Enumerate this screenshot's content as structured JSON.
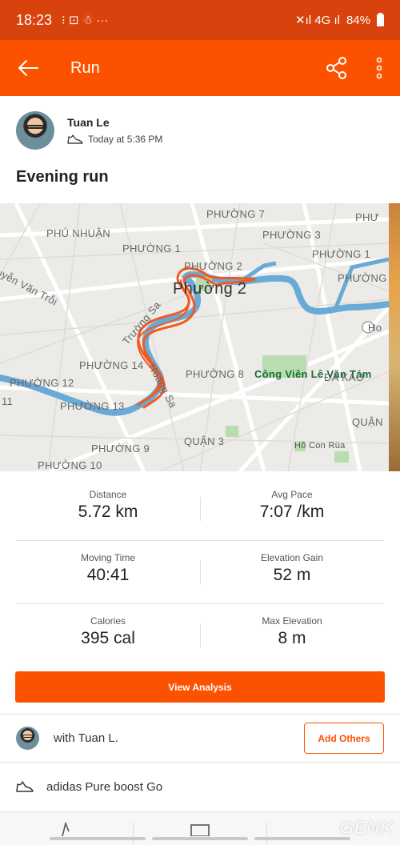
{
  "status_bar": {
    "time": "18:23",
    "left_glyphs": "⁝ ⊡ ☃ ···",
    "signal_glyphs": "✕ıl  4G ıl",
    "battery": "84%"
  },
  "app_bar": {
    "title": "Run",
    "back_icon": "arrow-left-icon",
    "share_icon": "share-icon",
    "more_icon": "more-vertical-icon",
    "color": "#fc5200"
  },
  "athlete": {
    "name": "Tuan Le",
    "activity_icon": "shoe-icon",
    "time": "Today at 5:36 PM"
  },
  "activity": {
    "title": "Evening run"
  },
  "map": {
    "labels": {
      "phuong7": "PHƯỜNG 7",
      "phuNhuan": "PHÚ NHUẬN",
      "phuong1a": "PHƯỜNG 1",
      "phuong3": "PHƯỜNG 3",
      "phuong1b": "PHƯỜNG 1",
      "phuong2caps": "PHƯỜNG 2",
      "phuong2big": "Phường 2",
      "nguyenVanTroi": "uyễn Văn Trỗi",
      "truongSa": "Trường Sa",
      "hoangSa": "Hoàng Sa",
      "phuong14": "PHƯỜNG 14",
      "phuong8": "PHƯỜNG 8",
      "congVien": "Công Viên Lê Văn Tám",
      "daKao": "ĐA KAO",
      "phuong12": "PHƯỜNG 12",
      "phuong13": "PHƯỜNG 13",
      "eleven": "11",
      "quan": "QUẬN",
      "phuong9": "PHƯỜNG 9",
      "quan3": "QUẬN 3",
      "hoCon": "Hồ Con Rùa",
      "phuong10": "PHƯỜNG 10",
      "phuTop": "PHƯ",
      "phuongRight": "PHƯỜNG",
      "ho": "Ho"
    },
    "route_color": "#f05a22",
    "river_color": "#6aaad6"
  },
  "stats": [
    [
      {
        "label": "Distance",
        "value": "5.72 km"
      },
      {
        "label": "Avg Pace",
        "value": "7:07 /km"
      }
    ],
    [
      {
        "label": "Moving Time",
        "value": "40:41"
      },
      {
        "label": "Elevation Gain",
        "value": "52 m"
      }
    ],
    [
      {
        "label": "Calories",
        "value": "395 cal"
      },
      {
        "label": "Max Elevation",
        "value": "8 m"
      }
    ]
  ],
  "actions": {
    "view_analysis": "View Analysis"
  },
  "with_row": {
    "text": "with Tuan L.",
    "add_others": "Add Others"
  },
  "gear": {
    "icon": "shoe-icon",
    "name": "adidas Pure boost Go"
  },
  "watermark": "GENK"
}
